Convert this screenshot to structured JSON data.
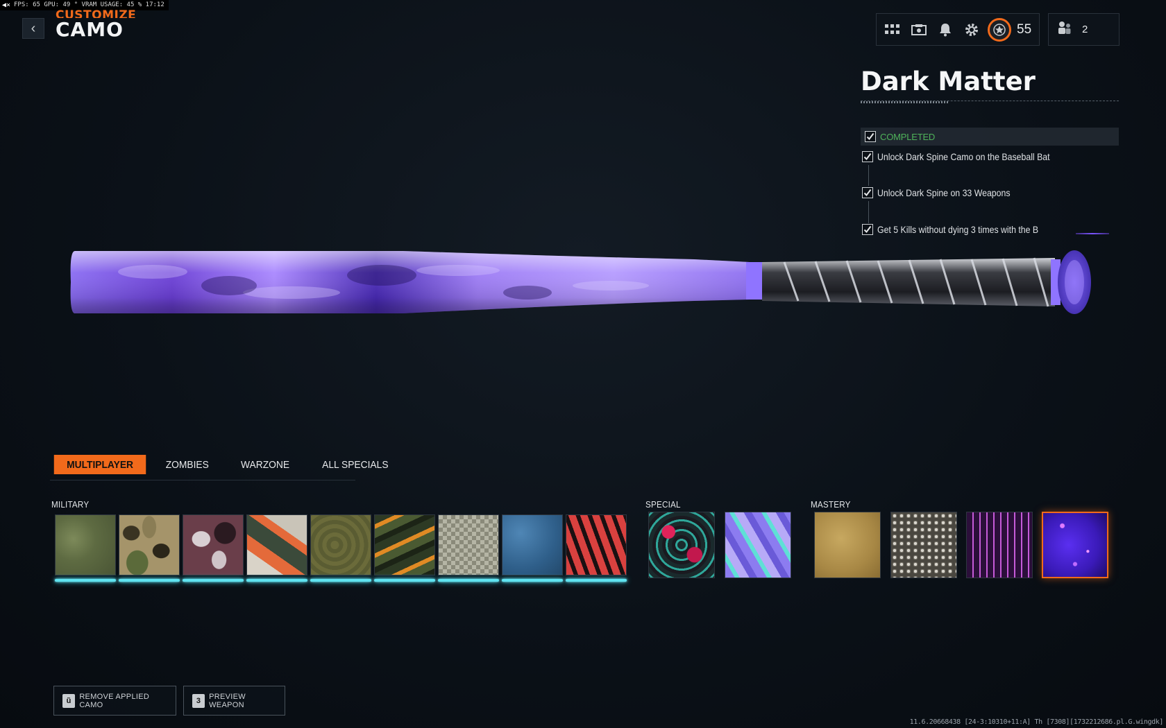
{
  "overlay": {
    "text": "FPS: 65  GPU: 49 °  VRAM USAGE: 45 %  17:12"
  },
  "header": {
    "overline": "CUSTOMIZE",
    "title": "CAMO"
  },
  "topbar": {
    "level": "55",
    "party_count": "2"
  },
  "camo": {
    "name": "Dark Matter",
    "status": "COMPLETED",
    "challenges": [
      "Unlock Dark Spine Camo on the Baseball Bat",
      "Unlock Dark Spine on 33 Weapons",
      "Get 5 Kills without dying 3 times with the B"
    ]
  },
  "tabs": [
    {
      "label": "MULTIPLAYER",
      "active": true
    },
    {
      "label": "ZOMBIES",
      "active": false
    },
    {
      "label": "WARZONE",
      "active": false
    },
    {
      "label": "ALL SPECIALS",
      "active": false
    }
  ],
  "sections": {
    "military": "MILITARY",
    "special": "SPECIAL",
    "mastery": "MASTERY"
  },
  "buttons": {
    "remove_key": "ũ",
    "remove_label": "REMOVE APPLIED CAMO",
    "preview_key": "3",
    "preview_label": "PREVIEW WEAPON"
  },
  "build_info": "11.6.20668438 [24-3:10310+11:A] Th [7308][1732212686.pl.G.wingdk]",
  "colors": {
    "accent": "#f26a1b",
    "completed": "#4fb35a",
    "progress_bar": "#5fe3f0"
  }
}
